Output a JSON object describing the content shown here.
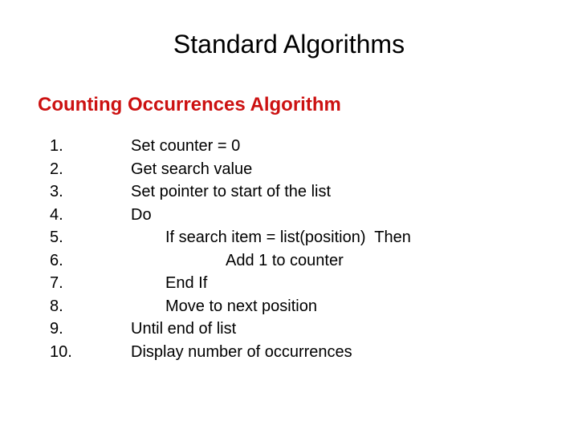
{
  "slide": {
    "title": "Standard Algorithms",
    "subtitle": "Counting Occurrences Algorithm",
    "subtitle_color": "#cc1111",
    "background_color": "#ffffff",
    "text_color": "#000000",
    "steps": [
      {
        "number": "1.",
        "text": "Set counter = 0",
        "indent": 0
      },
      {
        "number": "2.",
        "text": "Get search value",
        "indent": 0
      },
      {
        "number": "3.",
        "text": "Set pointer to start of the list",
        "indent": 0
      },
      {
        "number": "4.",
        "text": "Do",
        "indent": 0
      },
      {
        "number": "5.",
        "text": "If search item = list(position)  Then",
        "indent": 1
      },
      {
        "number": "6.",
        "text": "Add 1 to counter",
        "indent": 2
      },
      {
        "number": "7.",
        "text": "End If",
        "indent": 1
      },
      {
        "number": "8.",
        "text": "Move to next position",
        "indent": 1
      },
      {
        "number": "9.",
        "text": "Until end of list",
        "indent": 0
      },
      {
        "number": "10.",
        "text": "Display number of occurrences",
        "indent": 0
      }
    ]
  }
}
